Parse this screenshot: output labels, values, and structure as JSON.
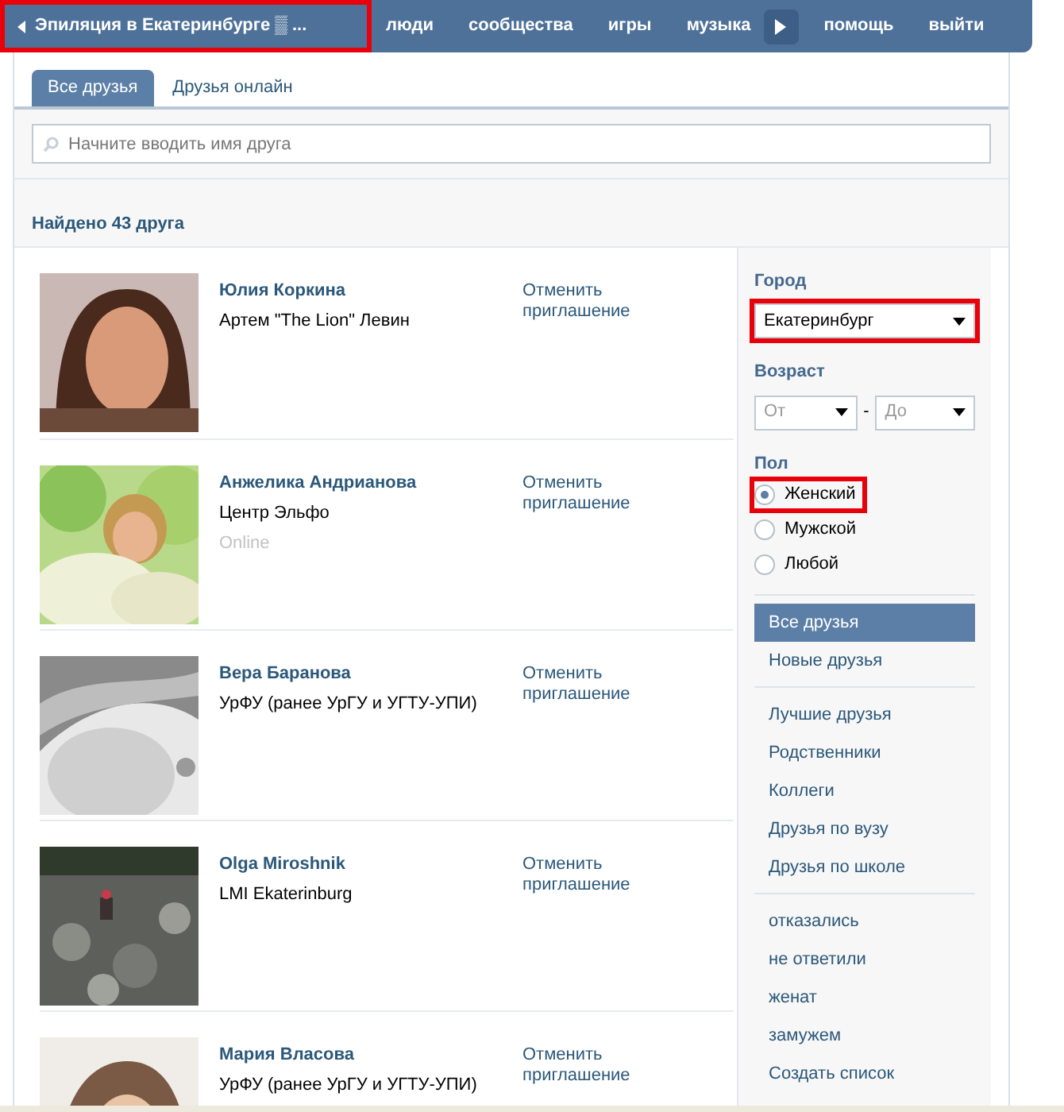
{
  "top_bar": {
    "back_link": {
      "label": "Эпиляция в Екатеринбурге ▒ ...",
      "highlighted": true
    },
    "menu": [
      {
        "label": "люди"
      },
      {
        "label": "сообщества"
      },
      {
        "label": "игры"
      },
      {
        "label": "музыка"
      },
      {
        "label": "помощь"
      },
      {
        "label": "выйти"
      }
    ]
  },
  "tabs": [
    {
      "label": "Все друзья",
      "selected": true
    },
    {
      "label": "Друзья онлайн",
      "selected": false
    }
  ],
  "search": {
    "placeholder": "Начните вводить имя друга"
  },
  "found": "Найдено 43 друга",
  "friends": [
    {
      "name": "Юлия Коркина",
      "info": "Артем \"The Lion\" Левин",
      "action": "Отменить приглашение"
    },
    {
      "name": "Анжелика Андрианова",
      "info": "Центр Эльфо",
      "status": "Online",
      "action": "Отменить приглашение"
    },
    {
      "name": "Вера Баранова",
      "info": "УрФУ (ранее УрГУ и УГТУ-УПИ)",
      "action": "Отменить приглашение"
    },
    {
      "name": "Olga Miroshnik",
      "info": "LMI Ekaterinburg",
      "action": "Отменить приглашение"
    },
    {
      "name": "Мария Власова",
      "info": "УрФУ (ранее УрГУ и УГТУ-УПИ)",
      "action": "Отменить приглашение"
    }
  ],
  "filters": {
    "city": {
      "label": "Город",
      "value": "Екатеринбург",
      "highlighted": true
    },
    "age": {
      "label": "Возраст",
      "from": "От",
      "to": "До",
      "separator": "-"
    },
    "gender": {
      "label": "Пол",
      "options": [
        {
          "label": "Женский",
          "selected": true,
          "highlighted": true
        },
        {
          "label": "Мужской",
          "selected": false,
          "highlighted": false
        },
        {
          "label": "Любой",
          "selected": false,
          "highlighted": false
        }
      ]
    }
  },
  "lists": [
    [
      {
        "label": "Все друзья",
        "selected": true
      },
      {
        "label": "Новые друзья",
        "selected": false
      }
    ],
    [
      {
        "label": "Лучшие друзья",
        "selected": false
      },
      {
        "label": "Родственники",
        "selected": false
      },
      {
        "label": "Коллеги",
        "selected": false
      },
      {
        "label": "Друзья по вузу",
        "selected": false
      },
      {
        "label": "Друзья по школе",
        "selected": false
      }
    ],
    [
      {
        "label": "отказались",
        "selected": false
      },
      {
        "label": "не ответили",
        "selected": false
      },
      {
        "label": "женат",
        "selected": false
      },
      {
        "label": "замужем",
        "selected": false
      },
      {
        "label": "Создать список",
        "selected": false
      }
    ]
  ]
}
